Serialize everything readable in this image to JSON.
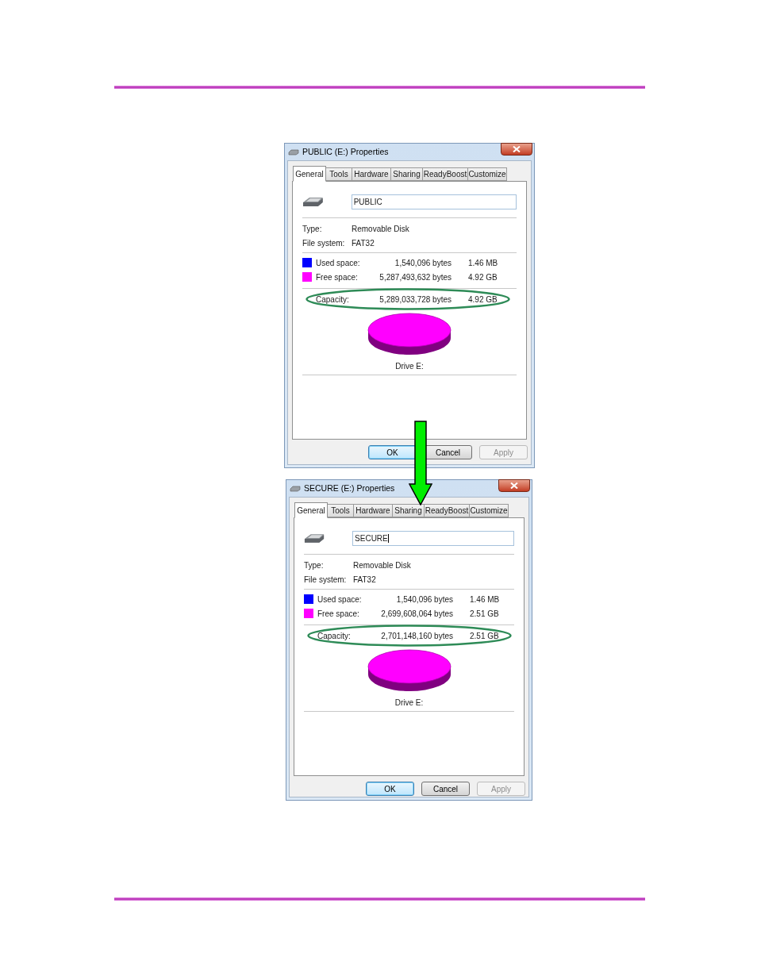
{
  "dialogs": [
    {
      "title": "PUBLIC (E:) Properties",
      "tabs": [
        {
          "label": "General",
          "selected": true
        },
        {
          "label": "Tools",
          "selected": false
        },
        {
          "label": "Hardware",
          "selected": false
        },
        {
          "label": "Sharing",
          "selected": false
        },
        {
          "label": "ReadyBoost",
          "selected": false
        },
        {
          "label": "Customize",
          "selected": false
        }
      ],
      "name_field": {
        "value": "PUBLIC",
        "caret": false
      },
      "properties": [
        {
          "label": "Type:",
          "value": "Removable Disk"
        },
        {
          "label": "File system:",
          "value": "FAT32"
        }
      ],
      "space": [
        {
          "label": "Used space:",
          "bytes": "1,540,096 bytes",
          "size": "1.46 MB",
          "color": "#0000ff"
        },
        {
          "label": "Free space:",
          "bytes": "5,287,493,632 bytes",
          "size": "4.92 GB",
          "color": "#ff00ff"
        }
      ],
      "capacity": {
        "label": "Capacity:",
        "bytes": "5,289,033,728 bytes",
        "size": "4.92 GB",
        "highlighted": true
      },
      "chart_label": "Drive E:",
      "buttons": [
        {
          "label": "OK",
          "default": true,
          "disabled": false
        },
        {
          "label": "Cancel",
          "default": false,
          "disabled": false
        },
        {
          "label": "Apply",
          "default": false,
          "disabled": true
        }
      ]
    },
    {
      "title": "SECURE (E:) Properties",
      "tabs": [
        {
          "label": "General",
          "selected": true
        },
        {
          "label": "Tools",
          "selected": false
        },
        {
          "label": "Hardware",
          "selected": false
        },
        {
          "label": "Sharing",
          "selected": false
        },
        {
          "label": "ReadyBoost",
          "selected": false
        },
        {
          "label": "Customize",
          "selected": false
        }
      ],
      "name_field": {
        "value": "SECURE",
        "caret": true
      },
      "properties": [
        {
          "label": "Type:",
          "value": "Removable Disk"
        },
        {
          "label": "File system:",
          "value": "FAT32"
        }
      ],
      "space": [
        {
          "label": "Used space:",
          "bytes": "1,540,096 bytes",
          "size": "1.46 MB",
          "color": "#0000ff"
        },
        {
          "label": "Free space:",
          "bytes": "2,699,608,064 bytes",
          "size": "2.51 GB",
          "color": "#ff00ff"
        }
      ],
      "capacity": {
        "label": "Capacity:",
        "bytes": "2,701,148,160 bytes",
        "size": "2.51 GB",
        "highlighted": true
      },
      "chart_label": "Drive E:",
      "buttons": [
        {
          "label": "OK",
          "default": true,
          "disabled": false
        },
        {
          "label": "Cancel",
          "default": false,
          "disabled": false
        },
        {
          "label": "Apply",
          "default": false,
          "disabled": true
        }
      ]
    }
  ]
}
